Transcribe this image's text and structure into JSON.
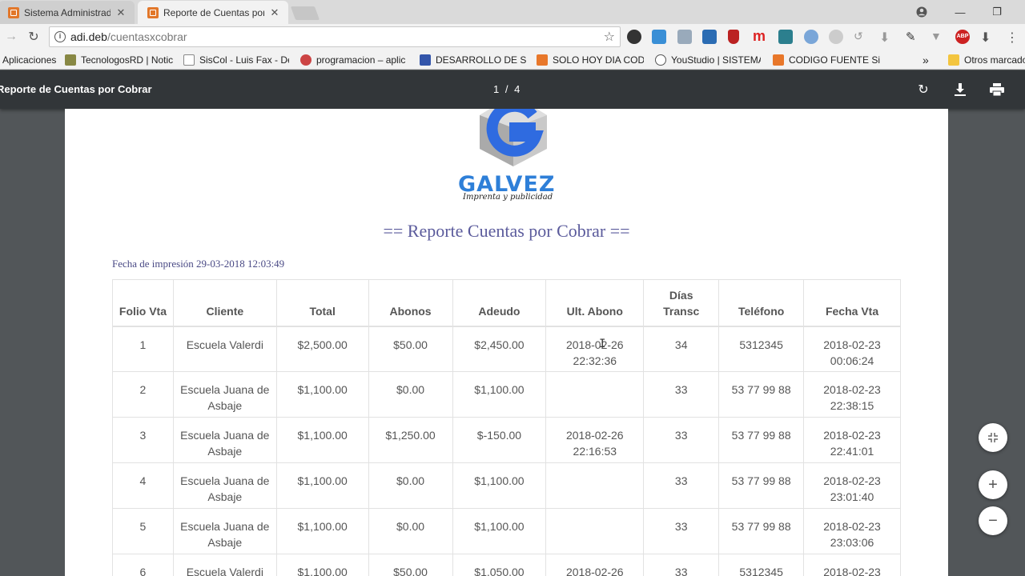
{
  "browser": {
    "tabs": [
      {
        "title": "Sistema Administrador d",
        "active": false
      },
      {
        "title": "Reporte de Cuentas por C",
        "active": true
      }
    ],
    "url_host": "adi.deb",
    "url_path": "/cuentasxcobrar",
    "bookmarks": [
      "Aplicaciones",
      "TecnologosRD | Notic",
      "SisCol - Luis Fax - De",
      "programacion – aplic",
      "DESARROLLO DE SIST",
      "SOLO HOY DIA CODI",
      "YouStudio | SISTEMA",
      "CODIGO FUENTE Sist"
    ],
    "bookmarks_overflow": "»",
    "other_bookmarks": "Otros marcado"
  },
  "pdf_viewer": {
    "title": "Reporte de Cuentas por Cobrar",
    "page_indicator": "1 / 4"
  },
  "report": {
    "brand": "GALVEZ",
    "tagline": "Imprenta y publicidad",
    "title": "== Reporte Cuentas por Cobrar ==",
    "print_date": "Fecha de impresión 29-03-2018 12:03:49",
    "columns": [
      "Folio Vta",
      "Cliente",
      "Total",
      "Abonos",
      "Adeudo",
      "Ult. Abono",
      "Días Transc",
      "Teléfono",
      "Fecha Vta"
    ],
    "rows": [
      [
        "1",
        "Escuela Valerdi",
        "$2,500.00",
        "$50.00",
        "$2,450.00",
        "2018-02-26 22:32:36",
        "34",
        "5312345",
        "2018-02-23 00:06:24"
      ],
      [
        "2",
        "Escuela Juana de Asbaje",
        "$1,100.00",
        "$0.00",
        "$1,100.00",
        "",
        "33",
        "53 77 99 88",
        "2018-02-23 22:38:15"
      ],
      [
        "3",
        "Escuela Juana de Asbaje",
        "$1,100.00",
        "$1,250.00",
        "$-150.00",
        "2018-02-26 22:16:53",
        "33",
        "53 77 99 88",
        "2018-02-23 22:41:01"
      ],
      [
        "4",
        "Escuela Juana de Asbaje",
        "$1,100.00",
        "$0.00",
        "$1,100.00",
        "",
        "33",
        "53 77 99 88",
        "2018-02-23 23:01:40"
      ],
      [
        "5",
        "Escuela Juana de Asbaje",
        "$1,100.00",
        "$0.00",
        "$1,100.00",
        "",
        "33",
        "53 77 99 88",
        "2018-02-23 23:03:06"
      ],
      [
        "6",
        "Escuela Valerdi",
        "$1,100.00",
        "$50.00",
        "$1,050.00",
        "2018-02-26",
        "33",
        "5312345",
        "2018-02-23"
      ]
    ]
  },
  "colors": {
    "pdf_toolbar": "#323639",
    "viewer_bg": "#525659",
    "brand_blue": "#2e7fd8",
    "title_purple": "#5b5b9c"
  }
}
